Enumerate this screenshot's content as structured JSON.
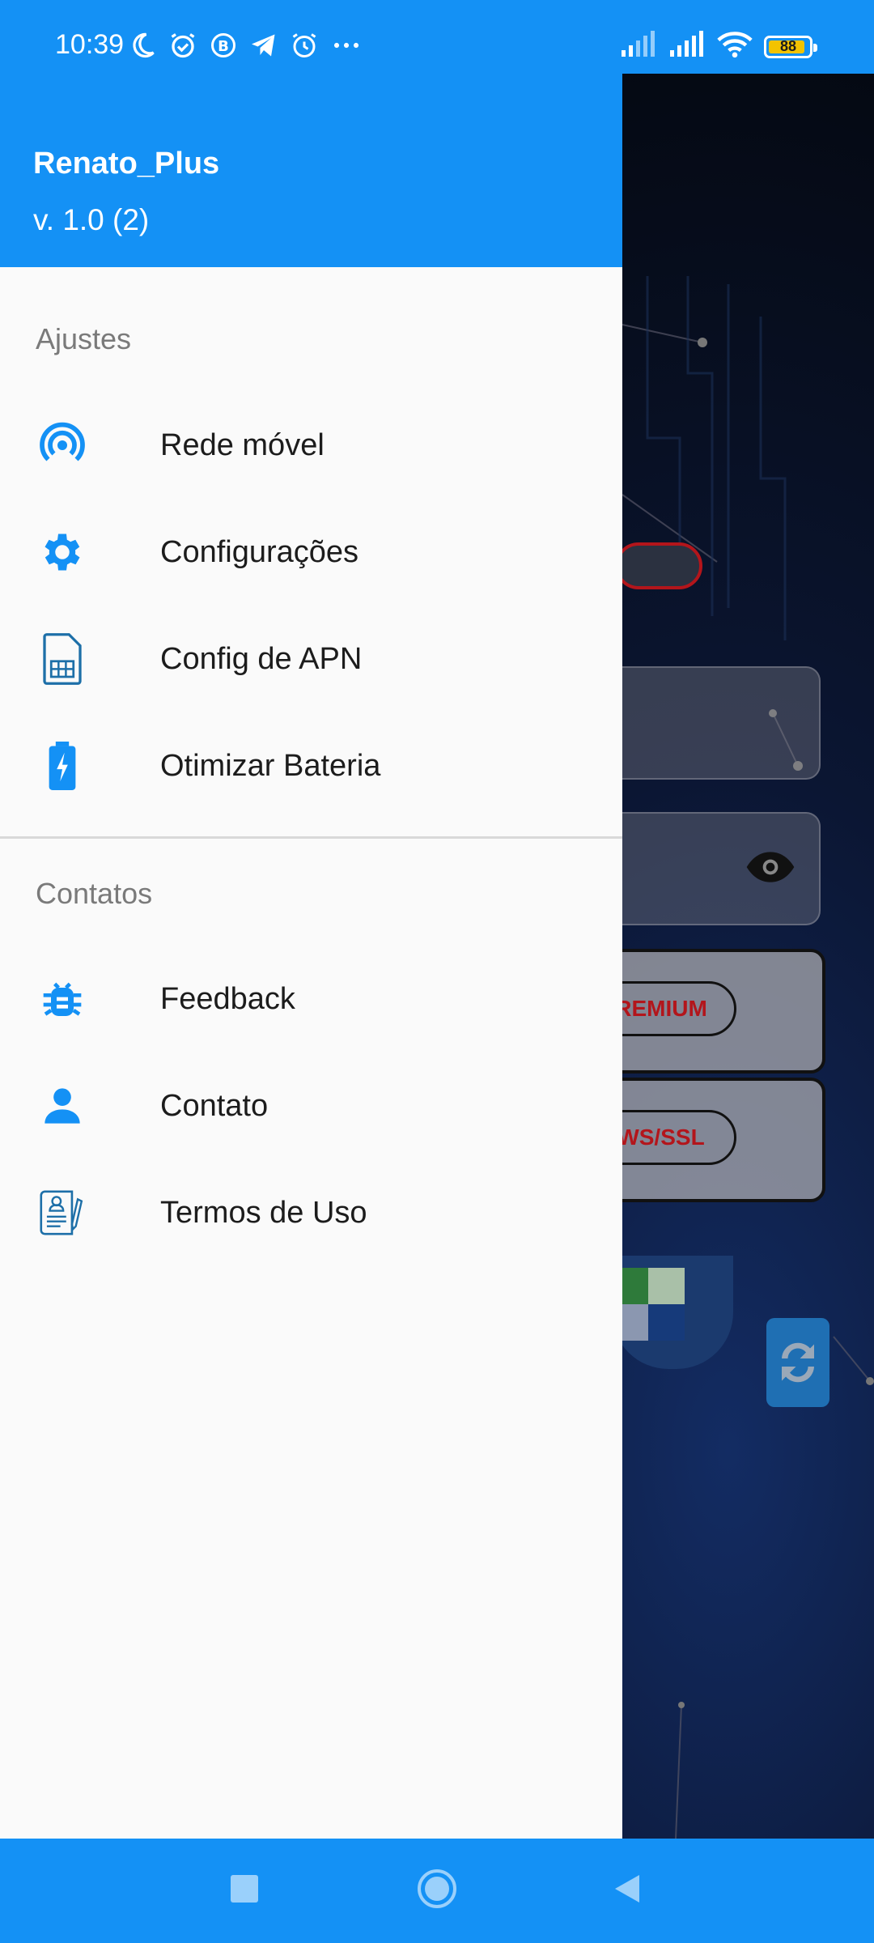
{
  "status_bar": {
    "time": "10:39",
    "battery_level": "88",
    "left_icons": [
      "moon-icon",
      "alarm-icon",
      "b-badge-icon",
      "telegram-icon",
      "alarm-clock-icon",
      "more-dots-icon"
    ],
    "right_icons": [
      "signal-icon",
      "signal-icon",
      "wifi-icon",
      "battery-icon"
    ]
  },
  "drawer": {
    "app_name": "Renato_Plus",
    "version": "v. 1.0 (2)",
    "sections": [
      {
        "title": "Ajustes",
        "items": [
          {
            "label": "Rede móvel",
            "icon": "signal-tower-icon"
          },
          {
            "label": "Configurações",
            "icon": "gear-icon"
          },
          {
            "label": "Config de APN",
            "icon": "sim-card-icon"
          },
          {
            "label": "Otimizar Bateria",
            "icon": "battery-charging-icon"
          }
        ]
      },
      {
        "title": "Contatos",
        "items": [
          {
            "label": "Feedback",
            "icon": "bug-icon"
          },
          {
            "label": "Contato",
            "icon": "person-icon"
          },
          {
            "label": "Termos de Uso",
            "icon": "document-icon"
          }
        ]
      }
    ]
  },
  "background": {
    "pill_1": "REMIUM",
    "pill_2": "WS/SSL"
  },
  "nav_bar": {
    "buttons": [
      "recents-button",
      "home-button",
      "back-button"
    ]
  },
  "colors": {
    "accent": "#1491f5",
    "drawer_bg": "#fafafa",
    "text_primary": "#1c1c1c",
    "text_secondary": "#7a7a7a"
  }
}
